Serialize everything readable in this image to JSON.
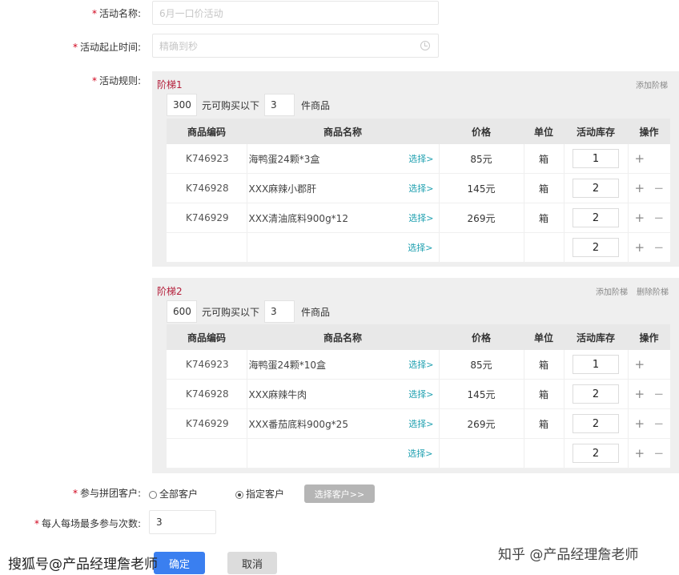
{
  "form": {
    "activity_name": {
      "label": "活动名称:",
      "placeholder": "6月一口价活动"
    },
    "activity_time": {
      "label": "活动起止时间:",
      "placeholder": "精确到秒"
    },
    "rules_label": "活动规则:",
    "required_mark": "*"
  },
  "tiers": [
    {
      "title": "阶梯1",
      "links": [
        "添加阶梯"
      ],
      "amount": "300",
      "rule_text_mid": "元可购买以下",
      "quantity": "3",
      "rule_text_end": "件商品",
      "rows": [
        {
          "code": "K746923",
          "name": "海鸭蛋24颗*3盒",
          "select": "选择>",
          "price": "85元",
          "unit": "箱",
          "stock": "1",
          "ops": [
            "+"
          ]
        },
        {
          "code": "K746928",
          "name": "XXX麻辣小郡肝",
          "select": "选择>",
          "price": "145元",
          "unit": "箱",
          "stock": "2",
          "ops": [
            "+",
            "−"
          ]
        },
        {
          "code": "K746929",
          "name": "XXX清油底料900g*12",
          "select": "选择>",
          "price": "269元",
          "unit": "箱",
          "stock": "2",
          "ops": [
            "+",
            "−"
          ]
        },
        {
          "code": "",
          "name": "",
          "select": "选择>",
          "price": "",
          "unit": "",
          "stock": "2",
          "ops": [
            "+",
            "−"
          ]
        }
      ]
    },
    {
      "title": "阶梯2",
      "links": [
        "添加阶梯",
        "删除阶梯"
      ],
      "amount": "600",
      "rule_text_mid": "元可购买以下",
      "quantity": "3",
      "rule_text_end": "件商品",
      "rows": [
        {
          "code": "K746923",
          "name": "海鸭蛋24颗*10盒",
          "select": "选择>",
          "price": "85元",
          "unit": "箱",
          "stock": "1",
          "ops": [
            "+"
          ]
        },
        {
          "code": "K746928",
          "name": "XXX麻辣牛肉",
          "select": "选择>",
          "price": "145元",
          "unit": "箱",
          "stock": "2",
          "ops": [
            "+",
            "−"
          ]
        },
        {
          "code": "K746929",
          "name": "XXX番茄底料900g*25",
          "select": "选择>",
          "price": "269元",
          "unit": "箱",
          "stock": "2",
          "ops": [
            "+",
            "−"
          ]
        },
        {
          "code": "",
          "name": "",
          "select": "选择>",
          "price": "",
          "unit": "",
          "stock": "2",
          "ops": [
            "+",
            "−"
          ]
        }
      ]
    }
  ],
  "table_headers": [
    "商品编码",
    "商品名称",
    "价格",
    "单位",
    "活动库存",
    "操作"
  ],
  "customers": {
    "label": "参与拼团客户:",
    "option_all": "全部客户",
    "option_specified": "指定客户",
    "selected": "指定客户",
    "select_button": "选择客户>>"
  },
  "max_times": {
    "label": "每人每场最多参与次数:",
    "value": "3"
  },
  "buttons": {
    "confirm": "确定",
    "cancel": "取消"
  },
  "watermarks": {
    "left": "搜狐号@产品经理詹老师",
    "right": "知乎 @产品经理詹老师"
  },
  "colors": {
    "required": "#d0021b",
    "tier_title": "#b41e3a",
    "link": "#1fa0b0",
    "primary": "#3a7ff0",
    "panel": "#efefef"
  },
  "icons": {
    "time_picker": "clock-icon",
    "radio": "radio-icon"
  }
}
